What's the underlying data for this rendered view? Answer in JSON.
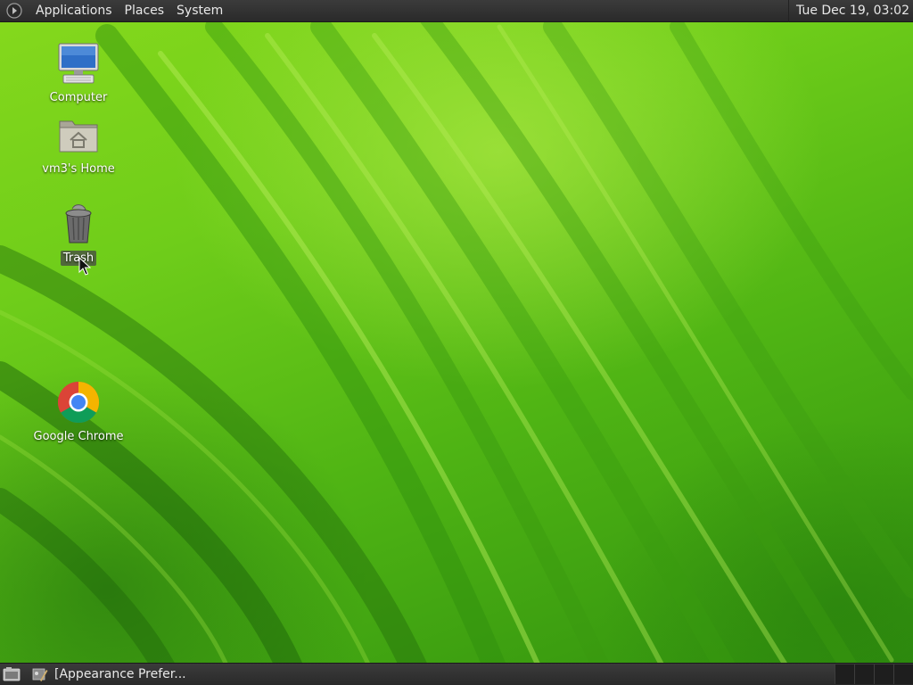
{
  "top_panel": {
    "menus": [
      "Applications",
      "Places",
      "System"
    ],
    "clock": "Tue Dec 19, 03:02"
  },
  "desktop": {
    "icons": [
      {
        "label": "Computer",
        "icon": "computer-icon"
      },
      {
        "label": "vm3's Home",
        "icon": "home-folder-icon"
      },
      {
        "label": "Trash",
        "icon": "trash-icon",
        "selected": true
      },
      {
        "label": "Google Chrome",
        "icon": "chrome-icon"
      }
    ]
  },
  "bottom_panel": {
    "show_desktop_icon": "show-desktop-icon",
    "task": {
      "label": "[Appearance Prefer...",
      "icon": "appearance-preferences-icon"
    },
    "workspace_count": 4
  },
  "colors": {
    "panel": "#2f2f2f",
    "panel_text": "#e8e8e8",
    "wallpaper_green": "#5fc01a"
  }
}
